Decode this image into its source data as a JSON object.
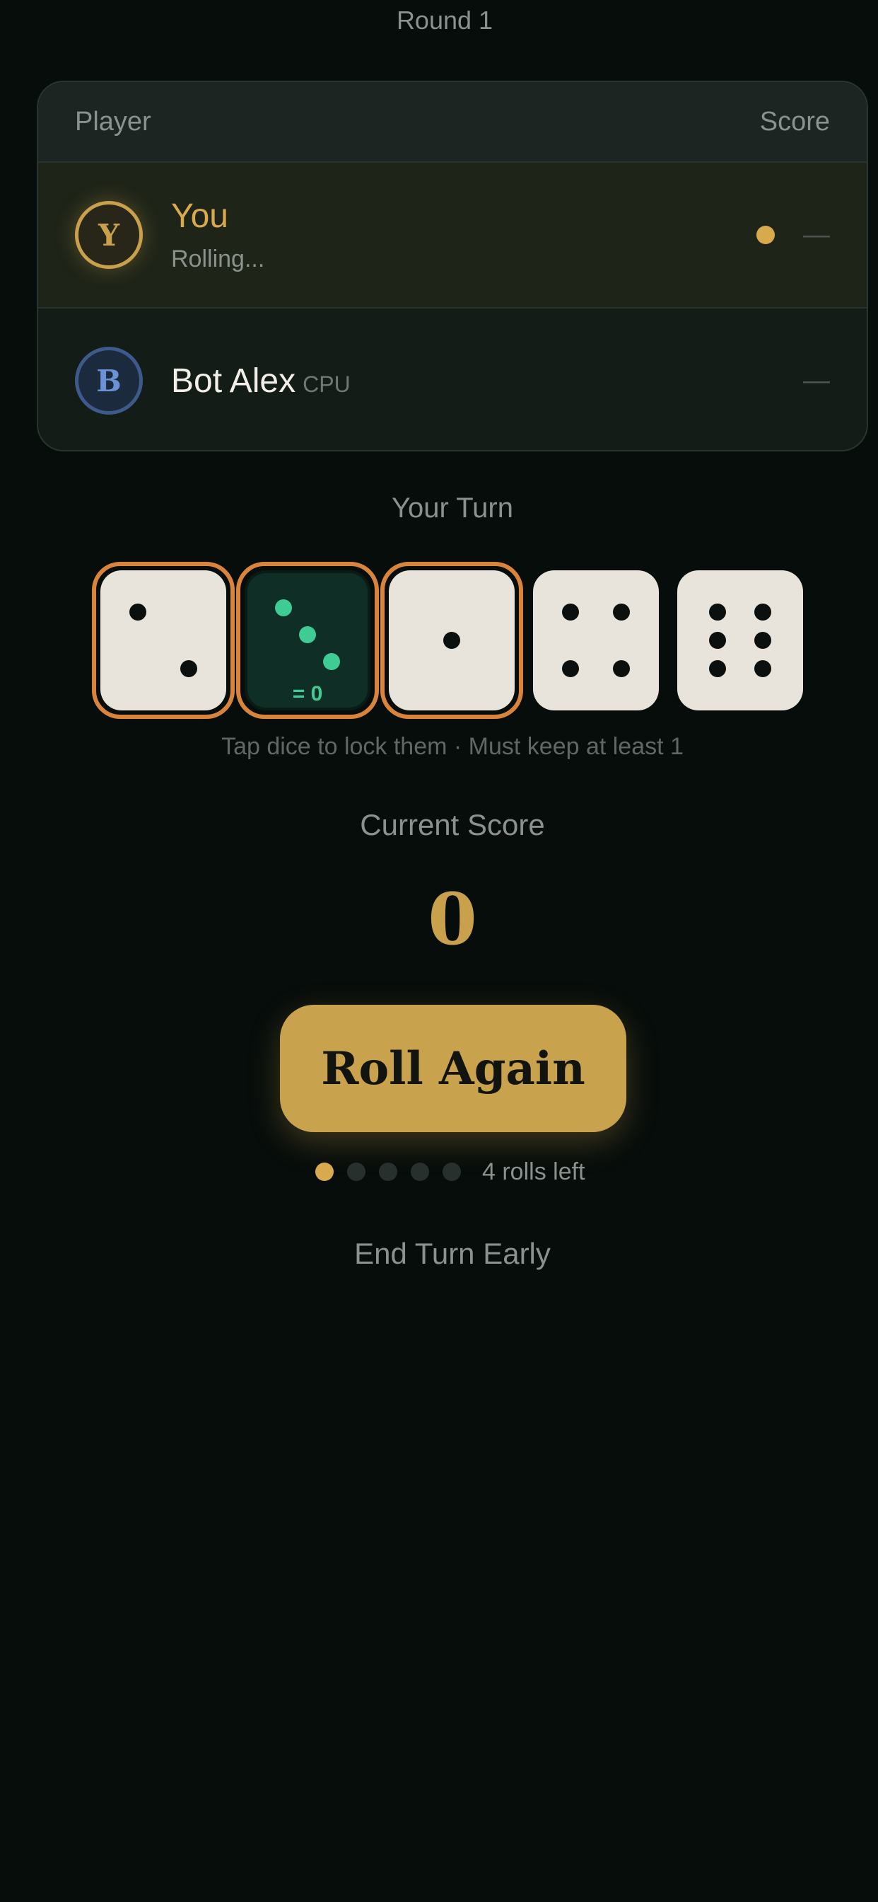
{
  "header": {
    "round_label": "Round 1"
  },
  "scoreboard": {
    "col_player": "Player",
    "col_score": "Score",
    "players": [
      {
        "initial": "Y",
        "name": "You",
        "status": "Rolling...",
        "score": "—",
        "active": true,
        "color": "#c9a14c"
      },
      {
        "initial": "B",
        "name": "Bot Alex",
        "tag": "CPU",
        "score": "—",
        "active": false,
        "color": "#6b91d6"
      }
    ]
  },
  "turn": {
    "label": "Your Turn",
    "dice": [
      {
        "value": 2,
        "locked": true,
        "scored": false
      },
      {
        "value": 3,
        "locked": true,
        "scored": true,
        "score_label": "= 0"
      },
      {
        "value": 1,
        "locked": true,
        "scored": false
      },
      {
        "value": 4,
        "locked": false,
        "scored": false
      },
      {
        "value": 6,
        "locked": false,
        "scored": false
      }
    ],
    "hint": "Tap dice to lock them · Must keep at least 1"
  },
  "score": {
    "label": "Current Score",
    "value": "0"
  },
  "actions": {
    "roll_label": "Roll Again",
    "rolls_total": 5,
    "rolls_used": 1,
    "rolls_left_label": "4 rolls left",
    "end_turn_label": "End Turn Early"
  },
  "colors": {
    "accent_gold": "#c9a24e",
    "lock_orange": "#d9843a",
    "scored_green": "#3ecb94",
    "background": "#070d0b"
  }
}
